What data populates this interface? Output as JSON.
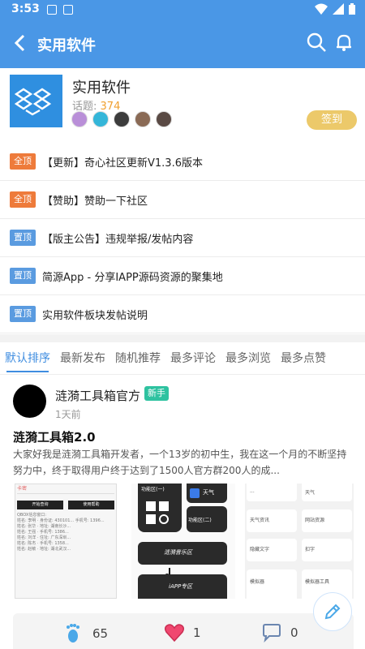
{
  "status_bar": {
    "time": "3:53"
  },
  "app_bar": {
    "title": "实用软件"
  },
  "forum": {
    "name": "实用软件",
    "topics_label": "话题:",
    "topics_count": "374",
    "checkin_label": "签到"
  },
  "pinned": [
    {
      "badge": "全顶",
      "type": "all",
      "text": "【更新】奇心社区更新V1.3.6版本"
    },
    {
      "badge": "全顶",
      "type": "all",
      "text": "【赞助】赞助一下社区"
    },
    {
      "badge": "置顶",
      "type": "top",
      "text": "【版主公告】违规举报/发帖内容"
    },
    {
      "badge": "置顶",
      "type": "top",
      "text": "简源App - 分享IAPP源码资源的聚集地"
    },
    {
      "badge": "置顶",
      "type": "top",
      "text": "实用软件板块发帖说明"
    }
  ],
  "tabs": [
    "默认排序",
    "最新发布",
    "随机推荐",
    "最多评论",
    "最多浏览",
    "最多点赞"
  ],
  "post": {
    "author": "涟漪工具箱官方",
    "badge": "新手",
    "time": "1天前",
    "title": "涟漪工具箱2.0",
    "excerpt": "大家好我是涟漪工具箱开发者，一个13岁的初中生，我在这一个月的不断坚持努力中，终于取得用户终于达到了1500人官方群200人的成...",
    "likes": "65",
    "favorites": "1",
    "comments": "0"
  },
  "thumbs": {
    "t1": {
      "header": "卡密",
      "buttons": [
        "开始查询",
        "使用帮助"
      ],
      "lines": [
        "QBOX信息窗口:",
        "姓名: 李明 · 身份证: 430101... 手机号: 1396...",
        "姓名: 张华 · 地址: 湖南长沙...",
        "姓名: 王强 · 手机号: 1386...",
        "姓名: 刘洋 · 住址: 广东深圳...",
        "姓名: 陈杰 · 手机号: 1358...",
        "姓名: 赵敏 · 地址: 湖北武汉..."
      ]
    },
    "t2": {
      "items": [
        "功能区(一)",
        "天气",
        "功能区(二)",
        "涟漪音乐区",
        "iAPP专区"
      ]
    },
    "t3": {
      "items": [
        "...",
        "天气",
        "天气资讯",
        "网站资源",
        "隐藏文字",
        "扣字",
        "模拟器",
        "模拟器工具"
      ]
    }
  },
  "colors": {
    "primary": "#4a97e6",
    "pin_all": "#ee7b3b",
    "pin_top": "#5a9be0",
    "newbie": "#2ec2a0",
    "checkin": "#ecc96a"
  }
}
